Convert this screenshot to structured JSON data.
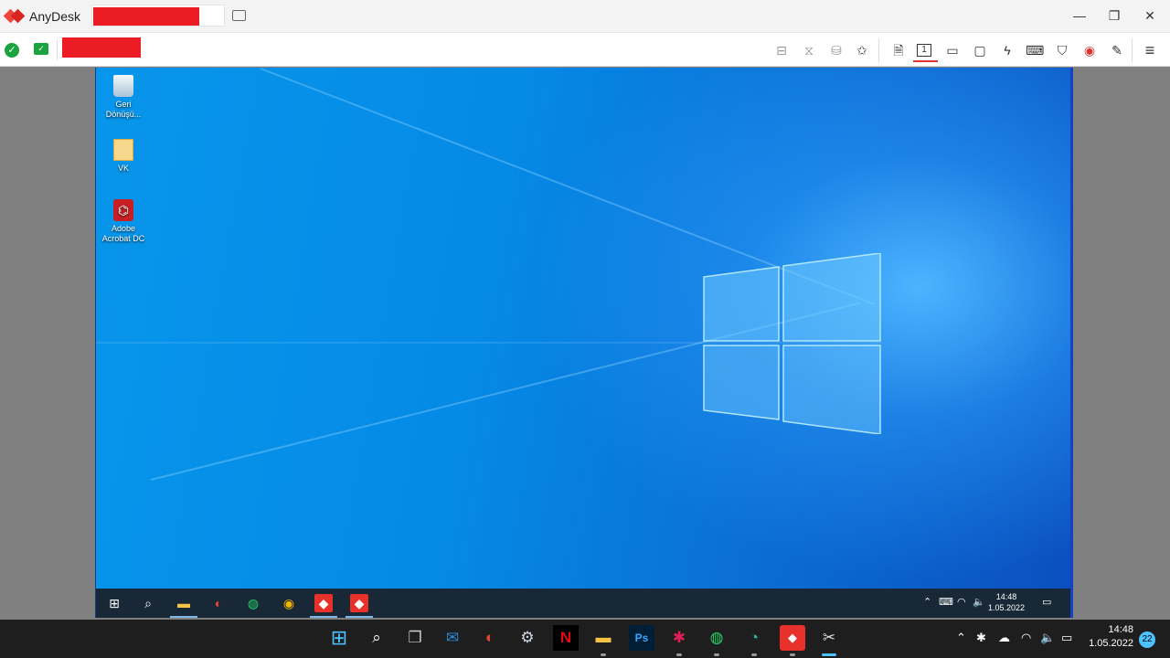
{
  "titlebar": {
    "app_name": "AnyDesk",
    "minimize": "—",
    "maximize": "❐",
    "close": "✕"
  },
  "toolbar": {
    "status": "✓",
    "monitor": "✓",
    "icons": [
      "privacy-icon",
      "hourglass-icon",
      "database-icon",
      "star-icon",
      "file-icon",
      "display-1-icon",
      "monitor-icon",
      "chat-icon",
      "lightning-icon",
      "keyboard-icon",
      "shield-icon",
      "record-icon",
      "pen-icon",
      "menu-icon"
    ],
    "display_number": "1"
  },
  "remote_desktop": {
    "icons": [
      {
        "label": "Geri Dönüşü..."
      },
      {
        "label": "VK"
      },
      {
        "label": "Adobe Acrobat DC"
      }
    ],
    "taskbar": {
      "time": "14:48",
      "date": "1.05.2022"
    }
  },
  "local_taskbar": {
    "time": "14:48",
    "date": "1.05.2022",
    "notifications": "22",
    "photoshop": "Ps",
    "netflix": "N"
  }
}
